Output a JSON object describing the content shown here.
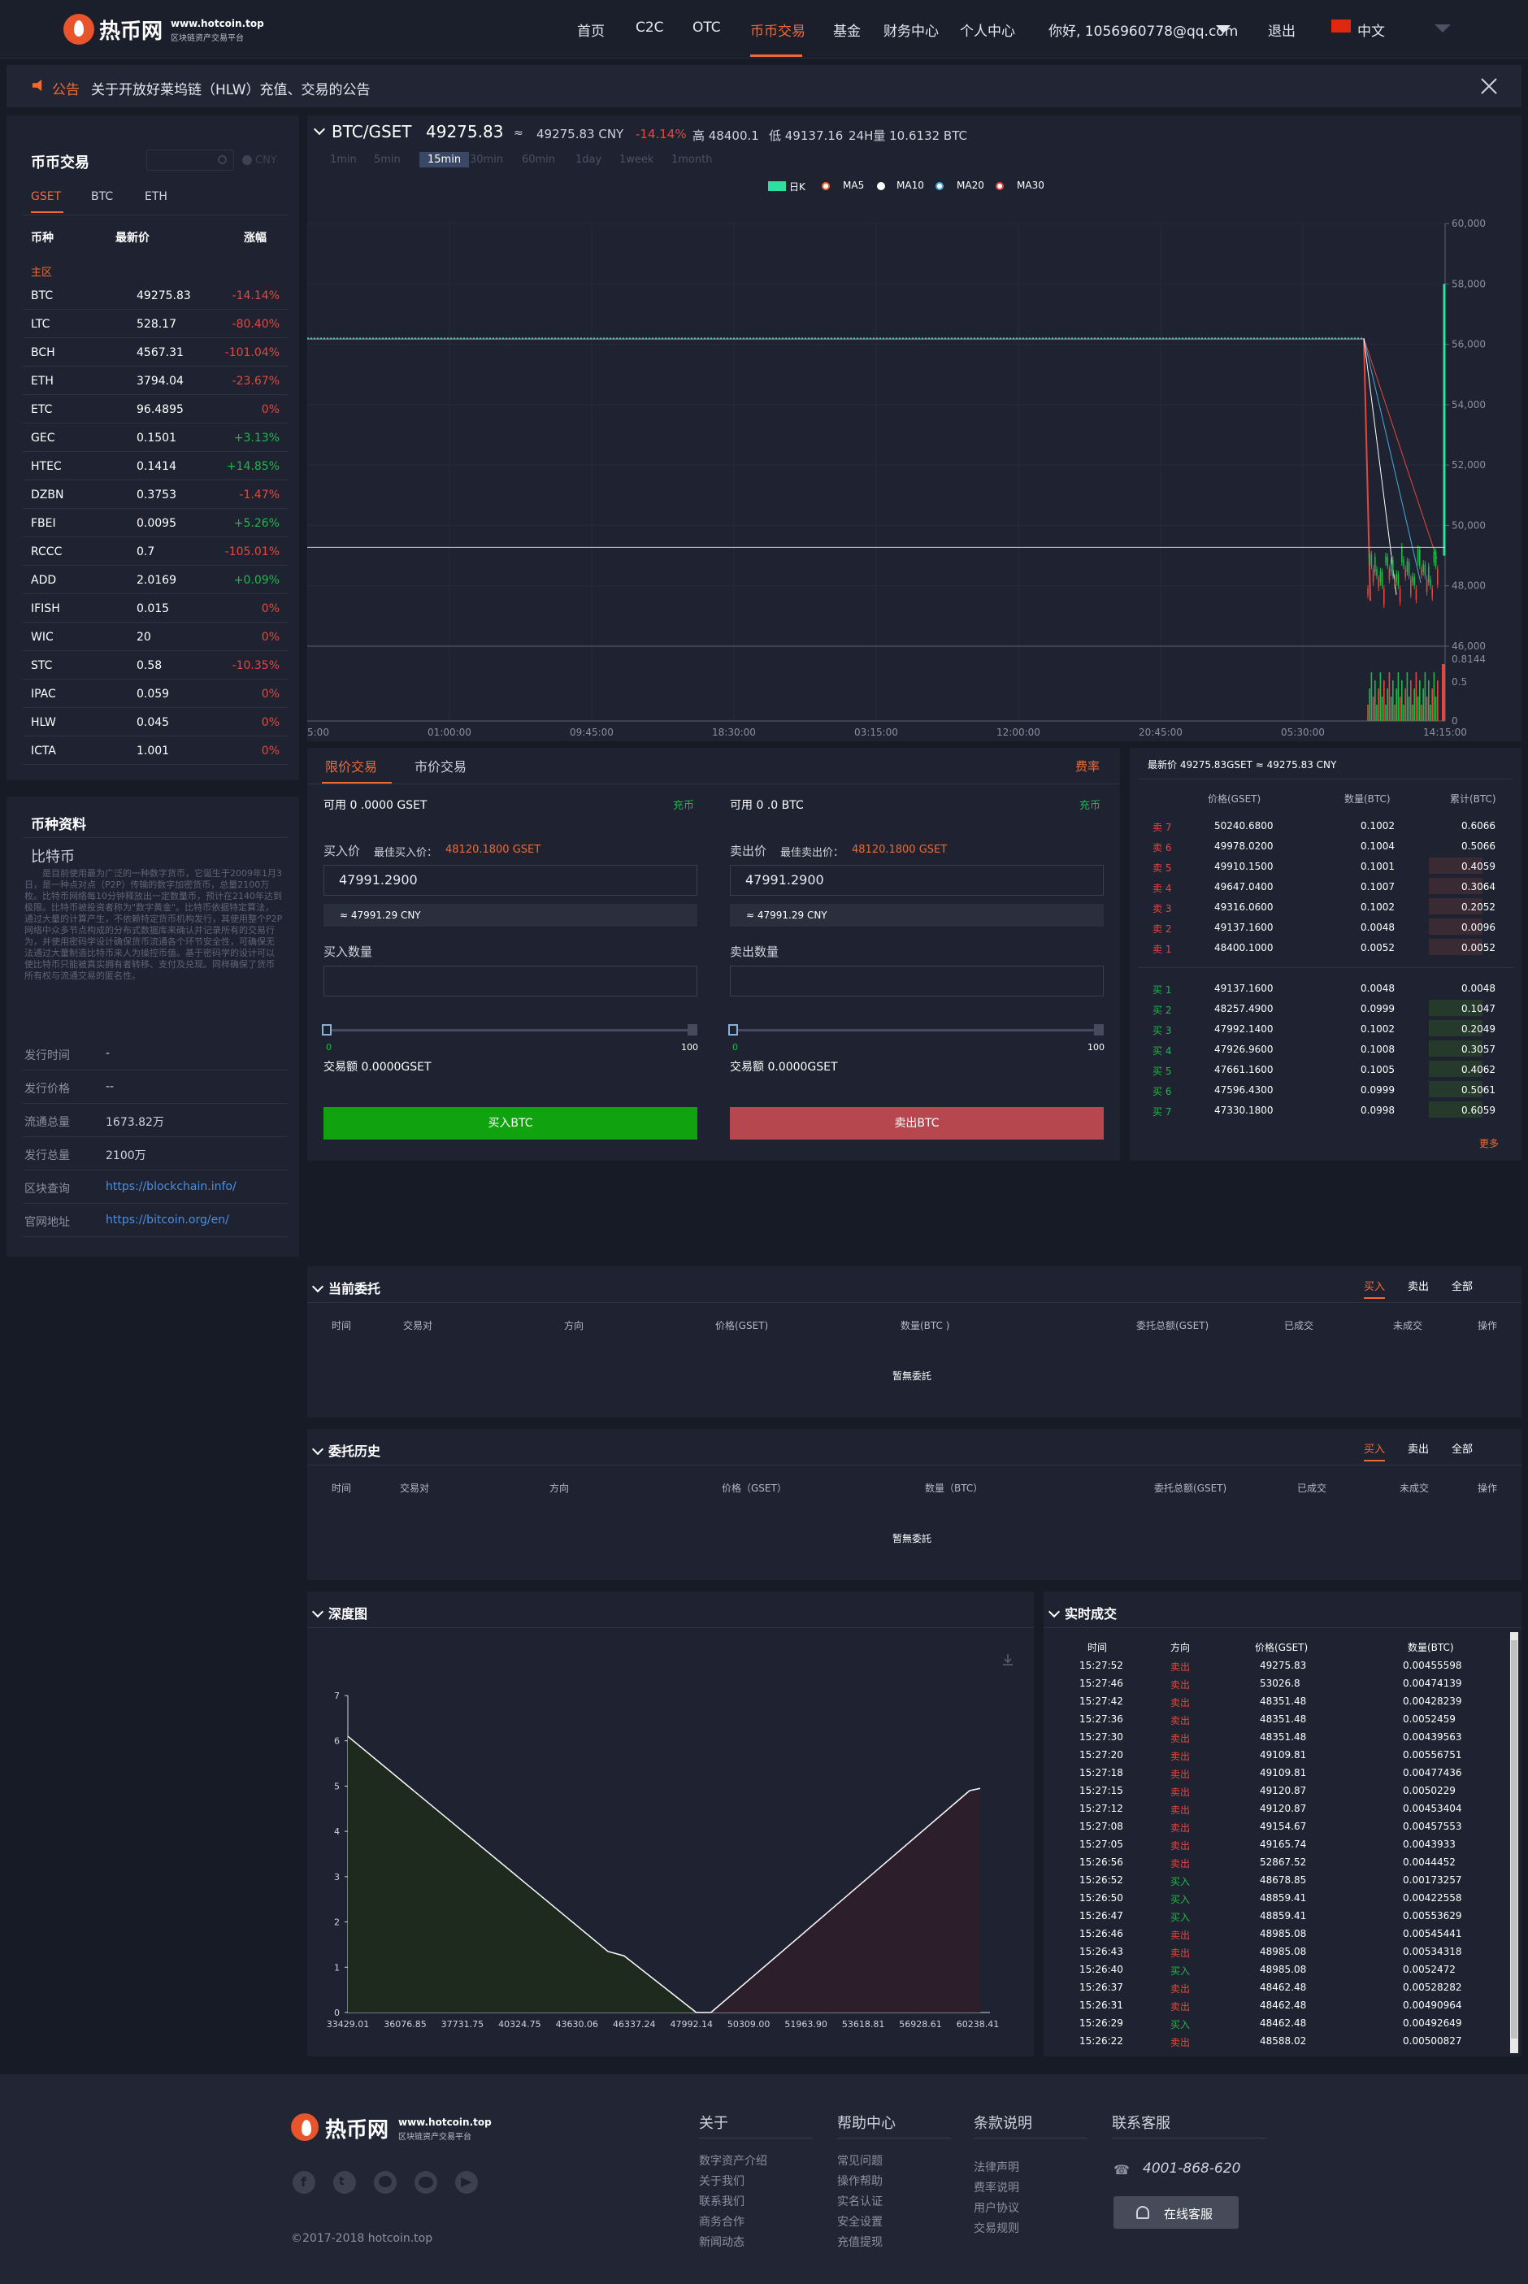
{
  "header": {
    "brand": "热币网",
    "brand_url": "www.hotcoin.top",
    "brand_sub": "区块链资产交易平台",
    "nav": [
      "首页",
      "C2C",
      "OTC",
      "币币交易",
      "基金",
      "财务中心",
      "个人中心"
    ],
    "user": "你好, 1056960778@qq.com",
    "logout": "退出",
    "lang": "中文"
  },
  "notice": {
    "tag": "公告",
    "text": "关于开放好莱坞链（HLW）充值、交易的公告"
  },
  "market": {
    "title": "币币交易",
    "cny": "CNY",
    "tabs": [
      "GSET",
      "BTC",
      "ETH"
    ],
    "cols": [
      "币种",
      "最新价",
      "涨幅"
    ],
    "zone": "主区",
    "rows": [
      {
        "coin": "BTC",
        "price": "49275.83",
        "change": "-14.14%",
        "dir": "down"
      },
      {
        "coin": "LTC",
        "price": "528.17",
        "change": "-80.40%",
        "dir": "down"
      },
      {
        "coin": "BCH",
        "price": "4567.31",
        "change": "-101.04%",
        "dir": "down"
      },
      {
        "coin": "ETH",
        "price": "3794.04",
        "change": "-23.67%",
        "dir": "down"
      },
      {
        "coin": "ETC",
        "price": "96.4895",
        "change": "0%",
        "dir": "down"
      },
      {
        "coin": "GEC",
        "price": "0.1501",
        "change": "+3.13%",
        "dir": "up"
      },
      {
        "coin": "HTEC",
        "price": "0.1414",
        "change": "+14.85%",
        "dir": "up"
      },
      {
        "coin": "DZBN",
        "price": "0.3753",
        "change": "-1.47%",
        "dir": "down"
      },
      {
        "coin": "FBEI",
        "price": "0.0095",
        "change": "+5.26%",
        "dir": "up"
      },
      {
        "coin": "RCCC",
        "price": "0.7",
        "change": "-105.01%",
        "dir": "down"
      },
      {
        "coin": "ADD",
        "price": "2.0169",
        "change": "+0.09%",
        "dir": "up"
      },
      {
        "coin": "IFISH",
        "price": "0.015",
        "change": "0%",
        "dir": "down"
      },
      {
        "coin": "WIC",
        "price": "20",
        "change": "0%",
        "dir": "down"
      },
      {
        "coin": "STC",
        "price": "0.58",
        "change": "-10.35%",
        "dir": "down"
      },
      {
        "coin": "IPAC",
        "price": "0.059",
        "change": "0%",
        "dir": "down"
      },
      {
        "coin": "HLW",
        "price": "0.045",
        "change": "0%",
        "dir": "down"
      },
      {
        "coin": "ICTA",
        "price": "1.001",
        "change": "0%",
        "dir": "down"
      }
    ]
  },
  "coininfo": {
    "title": "币种资料",
    "name": "比特币",
    "desc": "是目前使用最为广泛的一种数字货币，它诞生于2009年1月3日，是一种点对点（P2P）传输的数字加密货币，总量2100万枚。比特币网络每10分钟释放出一定数量币，预计在2140年达到极限。比特币被投资者称为\"数字黄金\"。比特币依据特定算法，通过大量的计算产生，不依赖特定货币机构发行，其使用整个P2P网络中众多节点构成的分布式数据库来确认并记录所有的交易行为，并使用密码学设计确保货币流通各个环节安全性，可确保无法通过大量制造比特币来人为操控币值。基于密码学的设计可以使比特币只能被真实拥有者转移、支付及兑现。同样确保了货币所有权与流通交易的匿名性。",
    "rows": [
      {
        "k": "发行时间",
        "v": "-"
      },
      {
        "k": "发行价格",
        "v": "--"
      },
      {
        "k": "流通总量",
        "v": "1673.82万"
      },
      {
        "k": "发行总量",
        "v": "2100万"
      },
      {
        "k": "区块查询",
        "v": "https://blockchain.info/"
      },
      {
        "k": "官网地址",
        "v": "https://bitcoin.org/en/"
      }
    ]
  },
  "ticker": {
    "pair": "BTC/GSET",
    "price": "49275.83",
    "approx": "≈",
    "cny": "49275.83 CNY",
    "change": "-14.14%",
    "high": "高 48400.1",
    "low": "低 49137.16",
    "vol": "24H量 10.6132 BTC"
  },
  "timeframes": [
    "1min",
    "5min",
    "15min",
    "30min",
    "60min",
    "1day",
    "1week",
    "1month"
  ],
  "legend": [
    "日K",
    "MA5",
    "MA10",
    "MA20",
    "MA30"
  ],
  "chart_data": {
    "type": "candlestick",
    "price_axis": [
      "60,000",
      "58,000",
      "56,000",
      "54,000",
      "52,000",
      "50,000",
      "48,000",
      "46,000"
    ],
    "ylim": [
      46000,
      60000
    ],
    "volume_axis": [
      "0.8144",
      "0.5",
      "0"
    ],
    "time_axis": [
      "5:00",
      "01:00:00",
      "09:45:00",
      "18:30:00",
      "03:15:00",
      "12:00:00",
      "20:45:00",
      "05:30:00",
      "14:15:00"
    ],
    "flat_price": 56200,
    "last_price": 49275.83
  },
  "trade": {
    "tabs": [
      "限价交易",
      "市价交易"
    ],
    "fee": "费率",
    "buy": {
      "avail": "可用 0 .0000 GSET",
      "deposit": "充币",
      "price_label": "买入价",
      "best_label": "最佳买入价：",
      "best": "48120.1800 GSET",
      "price": "47991.2900",
      "cny": "≈ 47991.29 CNY",
      "qty_label": "买入数量",
      "min": "0",
      "max": "100",
      "amount": "交易额 0.0000GSET",
      "button": "买入BTC"
    },
    "sell": {
      "avail": "可用 0 .0 BTC",
      "deposit": "充币",
      "price_label": "卖出价",
      "best_label": "最佳卖出价：",
      "best": "48120.1800 GSET",
      "price": "47991.2900",
      "cny": "≈ 47991.29 CNY",
      "qty_label": "卖出数量",
      "min": "0",
      "max": "100",
      "amount": "交易额 0.0000GSET",
      "button": "卖出BTC"
    }
  },
  "orderbook": {
    "latest": "最新价 49275.83GSET ≈ 49275.83 CNY",
    "cols": [
      "价格(GSET)",
      "数量(BTC)",
      "累计(BTC)"
    ],
    "asks": [
      {
        "label": "卖 7",
        "price": "50240.6800",
        "qty": "0.1002",
        "total": "0.6066",
        "depth": 0
      },
      {
        "label": "卖 6",
        "price": "49978.0200",
        "qty": "0.1004",
        "total": "0.5066",
        "depth": 0
      },
      {
        "label": "卖 5",
        "price": "49910.1500",
        "qty": "0.1001",
        "total": "0.4059",
        "depth": 0.6
      },
      {
        "label": "卖 4",
        "price": "49647.0400",
        "qty": "0.1007",
        "total": "0.3064",
        "depth": 0.6
      },
      {
        "label": "卖 3",
        "price": "49316.0600",
        "qty": "0.1002",
        "total": "0.2052",
        "depth": 0.6
      },
      {
        "label": "卖 2",
        "price": "49137.1600",
        "qty": "0.0048",
        "total": "0.0096",
        "depth": 0.6
      },
      {
        "label": "卖 1",
        "price": "48400.1000",
        "qty": "0.0052",
        "total": "0.0052",
        "depth": 0.6
      }
    ],
    "bids": [
      {
        "label": "买 1",
        "price": "49137.1600",
        "qty": "0.0048",
        "total": "0.0048",
        "depth": 0
      },
      {
        "label": "买 2",
        "price": "48257.4900",
        "qty": "0.0999",
        "total": "0.1047",
        "depth": 0.6
      },
      {
        "label": "买 3",
        "price": "47992.1400",
        "qty": "0.1002",
        "total": "0.2049",
        "depth": 0.6
      },
      {
        "label": "买 4",
        "price": "47926.9600",
        "qty": "0.1008",
        "total": "0.3057",
        "depth": 0.6
      },
      {
        "label": "买 5",
        "price": "47661.1600",
        "qty": "0.1005",
        "total": "0.4062",
        "depth": 0.6
      },
      {
        "label": "买 6",
        "price": "47596.4300",
        "qty": "0.0999",
        "total": "0.5061",
        "depth": 0.6
      },
      {
        "label": "买 7",
        "price": "47330.1800",
        "qty": "0.0998",
        "total": "0.6059",
        "depth": 0.6
      }
    ],
    "more": "更多"
  },
  "orders": {
    "current_title": "当前委托",
    "history_title": "委托历史",
    "filters": [
      "买入",
      "卖出",
      "全部"
    ],
    "cols_current": [
      "时间",
      "交易对",
      "方向",
      "价格(GSET)",
      "数量(BTC )",
      "委托总额(GSET)",
      "已成交",
      "未成交",
      "操作"
    ],
    "cols_history": [
      "时间",
      "交易对",
      "方向",
      "价格（GSET）",
      "数量（BTC）",
      "委托总额(GSET)",
      "已成交",
      "未成交",
      "操作"
    ],
    "empty": "暂無委託"
  },
  "depth": {
    "title": "深度图",
    "y": [
      "7",
      "6",
      "5",
      "4",
      "3",
      "2",
      "1",
      "0"
    ],
    "x": [
      "33429.01",
      "36076.85",
      "37731.75",
      "40324.75",
      "43630.06",
      "46337.24",
      "47992.14",
      "50309.00",
      "51963.90",
      "53618.81",
      "56928.61",
      "60238.41"
    ]
  },
  "trades": {
    "title": "实时成交",
    "cols": [
      "时间",
      "方向",
      "价格(GSET)",
      "数量(BTC)"
    ],
    "rows": [
      [
        "15:27:52",
        "卖出",
        "49275.83",
        "0.00455598"
      ],
      [
        "15:27:46",
        "卖出",
        "53026.8",
        "0.00474139"
      ],
      [
        "15:27:42",
        "卖出",
        "48351.48",
        "0.00428239"
      ],
      [
        "15:27:36",
        "卖出",
        "48351.48",
        "0.0052459"
      ],
      [
        "15:27:30",
        "卖出",
        "48351.48",
        "0.00439563"
      ],
      [
        "15:27:20",
        "卖出",
        "49109.81",
        "0.00556751"
      ],
      [
        "15:27:18",
        "卖出",
        "49109.81",
        "0.00477436"
      ],
      [
        "15:27:15",
        "卖出",
        "49120.87",
        "0.0050229"
      ],
      [
        "15:27:12",
        "卖出",
        "49120.87",
        "0.00453404"
      ],
      [
        "15:27:08",
        "卖出",
        "49154.67",
        "0.00457553"
      ],
      [
        "15:27:05",
        "卖出",
        "49165.74",
        "0.0043933"
      ],
      [
        "15:26:56",
        "卖出",
        "52867.52",
        "0.0044452"
      ],
      [
        "15:26:52",
        "买入",
        "48678.85",
        "0.00173257"
      ],
      [
        "15:26:50",
        "买入",
        "48859.41",
        "0.00422558"
      ],
      [
        "15:26:47",
        "买入",
        "48859.41",
        "0.00553629"
      ],
      [
        "15:26:46",
        "卖出",
        "48985.08",
        "0.00545441"
      ],
      [
        "15:26:43",
        "卖出",
        "48985.08",
        "0.00534318"
      ],
      [
        "15:26:40",
        "买入",
        "48985.08",
        "0.0052472"
      ],
      [
        "15:26:37",
        "卖出",
        "48462.48",
        "0.00528282"
      ],
      [
        "15:26:31",
        "卖出",
        "48462.48",
        "0.00490964"
      ],
      [
        "15:26:29",
        "买入",
        "48462.48",
        "0.00492649"
      ],
      [
        "15:26:22",
        "卖出",
        "48588.02",
        "0.00500827"
      ]
    ]
  },
  "footer": {
    "brand": "热币网",
    "brand_url": "www.hotcoin.top",
    "brand_sub": "区块链资产交易平台",
    "copyright": "©2017-2018 hotcoin.top",
    "cols": [
      {
        "title": "关于",
        "links": [
          "数字资产介绍",
          "关于我们",
          "联系我们",
          "商务合作",
          "新闻动态"
        ]
      },
      {
        "title": "帮助中心",
        "links": [
          "常见问题",
          "操作帮助",
          "实名认证",
          "安全设置",
          "充值提现"
        ]
      },
      {
        "title": "条款说明",
        "links": [
          "法律声明",
          "费率说明",
          "用户协议",
          "交易规则"
        ]
      }
    ],
    "service_title": "联系客服",
    "phone": "4001-868-620",
    "online": "在线客服"
  },
  "colors": {
    "accent": "#ef6a33",
    "up": "#21b74a",
    "down": "#e2483f",
    "buy_button": "#10a30f",
    "sell_button": "#b6474f"
  }
}
